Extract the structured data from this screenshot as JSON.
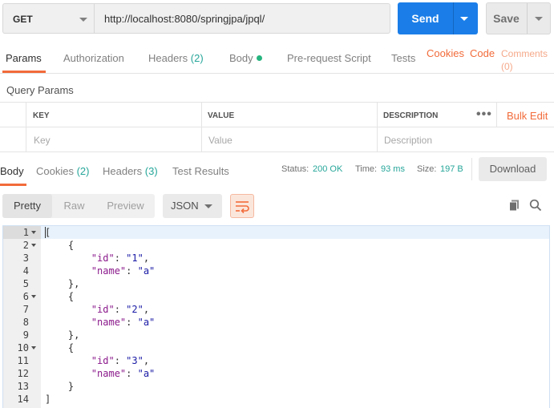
{
  "request": {
    "method": "GET",
    "url": "http://localhost:8080/springjpa/jpql/",
    "send_label": "Send",
    "save_label": "Save"
  },
  "request_tabs": {
    "params": "Params",
    "authorization": "Authorization",
    "headers": "Headers",
    "headers_count": "(2)",
    "body": "Body",
    "prerequest": "Pre-request Script",
    "tests": "Tests",
    "cookies": "Cookies",
    "code": "Code",
    "comments": "Comments",
    "comments_count": "(0)"
  },
  "query_params": {
    "title": "Query Params",
    "col_key": "KEY",
    "col_value": "VALUE",
    "col_description": "DESCRIPTION",
    "more": "•••",
    "bulk_edit": "Bulk Edit",
    "key_placeholder": "Key",
    "value_placeholder": "Value",
    "description_placeholder": "Description"
  },
  "response_tabs": {
    "body": "Body",
    "cookies": "Cookies",
    "cookies_count": "(2)",
    "headers": "Headers",
    "headers_count": "(3)",
    "test_results": "Test Results"
  },
  "response_meta": {
    "status_label": "Status:",
    "status_value": "200 OK",
    "time_label": "Time:",
    "time_value": "93 ms",
    "size_label": "Size:",
    "size_value": "197 B",
    "download_label": "Download"
  },
  "view_options": {
    "pretty": "Pretty",
    "raw": "Raw",
    "preview": "Preview",
    "format": "JSON"
  },
  "code_lines": [
    "[",
    "    {",
    "        \"id\": \"1\",",
    "        \"name\": \"a\"",
    "    },",
    "    {",
    "        \"id\": \"2\",",
    "        \"name\": \"a\"",
    "    },",
    "    {",
    "        \"id\": \"3\",",
    "        \"name\": \"a\"",
    "    }",
    "]"
  ],
  "line_numbers": [
    "1",
    "2",
    "3",
    "4",
    "5",
    "6",
    "7",
    "8",
    "9",
    "10",
    "11",
    "12",
    "13",
    "14"
  ],
  "colors": {
    "accent": "#f26b3a",
    "primary": "#1b7ee8",
    "success": "#26a69a"
  }
}
